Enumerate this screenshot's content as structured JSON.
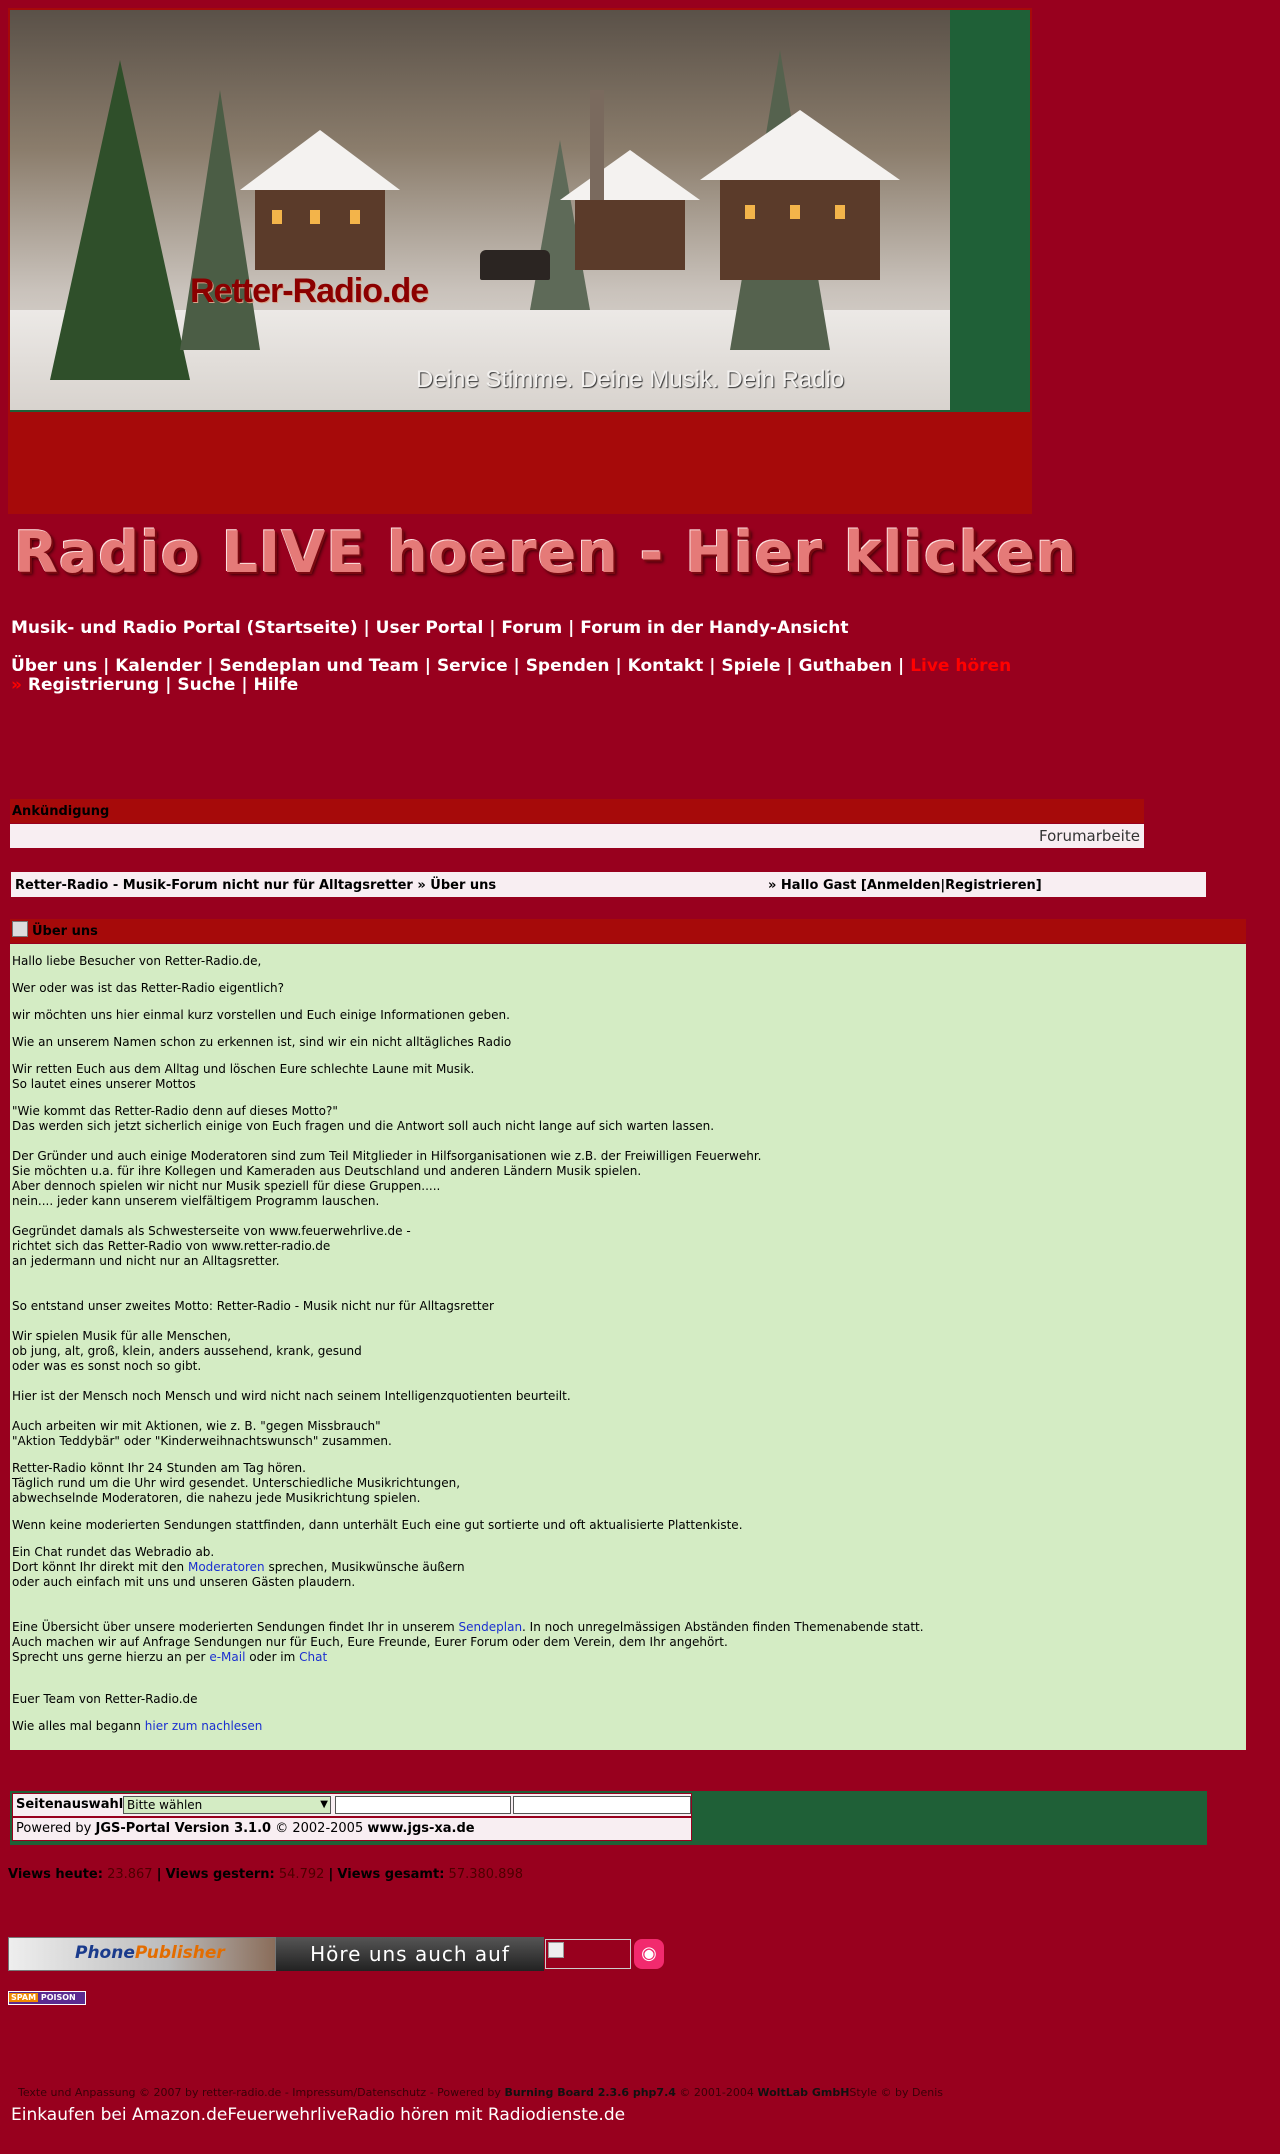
{
  "header": {
    "logo_text": "Retter-Radio.de",
    "slogan": "Deine Stimme. Deine Musik. Dein Radio",
    "live_banner": "Radio LIVE hoeren - Hier klicken"
  },
  "nav": {
    "row1": [
      "Musik- und Radio Portal (Startseite)",
      "User Portal",
      "Forum",
      "Forum in der Handy-Ansicht"
    ],
    "separator": "|",
    "row2": [
      "Über uns",
      "Kalender",
      "Sendeplan und Team",
      "Service",
      "Spenden",
      "Kontakt",
      "Spiele",
      "Guthaben"
    ],
    "live_link": "Live hören",
    "row3_prefix": "»",
    "row3": [
      "Registrierung",
      "Suche",
      "Hilfe"
    ]
  },
  "announcement": {
    "title": "Ankündigung",
    "ticker": "Forumarbeite"
  },
  "breadcrumb": {
    "path": "Retter-Radio - Musik-Forum nicht nur für Alltagsretter » Über uns",
    "greeting": "» Hallo Gast [",
    "login": "Anmelden",
    "pipe": "|",
    "register": "Registrieren",
    "close": "]"
  },
  "content": {
    "title": "Über uns",
    "p1": "Hallo liebe Besucher von Retter-Radio.de,",
    "p2": "Wer oder was ist das Retter-Radio eigentlich?",
    "p3": "wir möchten uns hier einmal kurz vorstellen und Euch einige Informationen geben.",
    "p4": "Wie an unserem Namen schon zu erkennen ist, sind wir ein nicht alltägliches Radio",
    "p5": "Wir retten Euch aus dem Alltag und löschen Eure schlechte Laune mit Musik.\nSo lautet eines unserer Mottos",
    "p6": "\"Wie kommt das Retter-Radio denn auf dieses Motto?\"\nDas werden sich jetzt sicherlich einige von Euch fragen und die Antwort soll auch nicht lange auf sich warten lassen.\n\nDer Gründer und auch einige Moderatoren sind zum Teil Mitglieder in Hilfsorganisationen wie z.B. der Freiwilligen Feuerwehr.\nSie möchten u.a. für ihre Kollegen und Kameraden aus Deutschland und anderen Ländern Musik spielen.\nAber dennoch spielen wir nicht nur Musik speziell für diese Gruppen.....\nnein.... jeder kann unserem vielfältigem Programm lauschen.\n\nGegründet damals als Schwesterseite von www.feuerwehrlive.de -\nrichtet sich das Retter-Radio von www.retter-radio.de\nan jedermann und nicht nur an Alltagsretter.\n\n\nSo entstand unser zweites Motto: Retter-Radio - Musik nicht nur für Alltagsretter\n\nWir spielen Musik für alle Menschen,\nob jung, alt, groß, klein, anders aussehend, krank, gesund\noder was es sonst noch so gibt.\n\nHier ist der Mensch noch Mensch und wird nicht nach seinem Intelligenzquotienten beurteilt.\n\nAuch arbeiten wir mit Aktionen, wie z. B. \"gegen Missbrauch\"\n\"Aktion Teddybär\" oder \"Kinderweihnachtswunsch\" zusammen.",
    "p7": "Retter-Radio könnt Ihr 24 Stunden am Tag hören.\nTäglich rund um die Uhr wird gesendet. Unterschiedliche Musikrichtungen,\nabwechselnde Moderatoren, die nahezu jede Musikrichtung spielen.",
    "p8": "Wenn keine moderierten Sendungen stattfinden, dann unterhält Euch eine gut sortierte und oft aktualisierte Plattenkiste.",
    "p9a": "Ein Chat rundet das Webradio ab.\nDort könnt Ihr direkt mit den ",
    "link_moderatoren": "Moderatoren",
    "p9b": " sprechen, Musikwünsche äußern\noder auch einfach mit uns und unseren Gästen plaudern.\n\n\nEine Übersicht über unsere moderierten Sendungen findet Ihr in unserem ",
    "link_sendeplan": "Sendeplan",
    "p9c": ". In noch unregelmässigen Abständen finden Themenabende statt.\nAuch machen wir auf Anfrage Sendungen nur für Euch, Eure Freunde, Eurer Forum oder dem Verein, dem Ihr angehört.\nSprecht uns gerne hierzu an per ",
    "link_email": "e-Mail",
    "p9d": " oder im ",
    "link_chat": "Chat",
    "p10": "\nEuer Team von Retter-Radio.de",
    "p11": "Wie alles mal begann ",
    "link_nachlesen": "hier zum nachlesen"
  },
  "footer": {
    "selector_label": "Seitenauswahl:",
    "select_value": "Bitte wählen",
    "powered_prefix": "Powered by ",
    "powered_name": "JGS-Portal Version 3.1.0",
    "powered_mid": " © 2002-2005 ",
    "powered_url": "www.jgs-xa.de"
  },
  "views": {
    "today_label": "Views heute:",
    "today": "23.867",
    "yesterday_label": "Views gestern:",
    "yesterday": "54.792",
    "total_label": "Views gesamt:",
    "total": "57.380.898",
    "sep": "|"
  },
  "ads": {
    "phone_a": "Phone",
    "phone_b": "Publisher",
    "hoere": "Höre uns auch auf",
    "spam_a": "SPAM",
    "spam_b": "POISON"
  },
  "credits": {
    "text1": "Texte und Anpassung © 2007 by retter-radio.de - Impressum/Datenschutz - Powered by ",
    "bb": "Burning Board 2.3.6 php7.4",
    "text2": " © 2001-2004 ",
    "woltlab": "WoltLab GmbH",
    "text3": "Style © by Denis"
  },
  "bottom_links": "Einkaufen bei Amazon.deFeuerwehrliveRadio hören mit Radiodienste.de",
  "colors": {
    "page_bg": "#98001e",
    "header_red": "#a60a0a",
    "dark_green": "#1f6037",
    "content_green": "#d4ecc4",
    "light_pink": "#f8eef2",
    "live_red": "#ff0000"
  }
}
